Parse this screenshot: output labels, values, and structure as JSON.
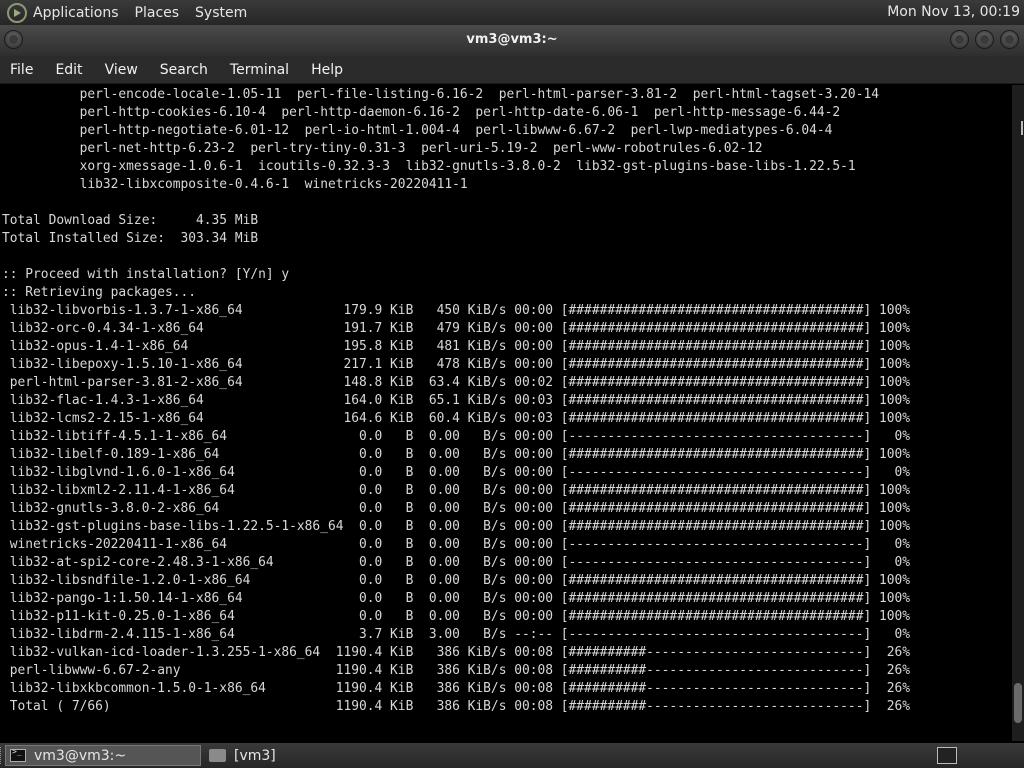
{
  "top_panel": {
    "menus": [
      "Applications",
      "Places",
      "System"
    ],
    "clock": "Mon Nov 13, 00:19"
  },
  "window": {
    "title": "vm3@vm3:~"
  },
  "menubar": [
    "File",
    "Edit",
    "View",
    "Search",
    "Terminal",
    "Help"
  ],
  "terminal": {
    "lines": [
      "          perl-encode-locale-1.05-11  perl-file-listing-6.16-2  perl-html-parser-3.81-2  perl-html-tagset-3.20-14",
      "          perl-http-cookies-6.10-4  perl-http-daemon-6.16-2  perl-http-date-6.06-1  perl-http-message-6.44-2",
      "          perl-http-negotiate-6.01-12  perl-io-html-1.004-4  perl-libwww-6.67-2  perl-lwp-mediatypes-6.04-4",
      "          perl-net-http-6.23-2  perl-try-tiny-0.31-3  perl-uri-5.19-2  perl-www-robotrules-6.02-12",
      "          xorg-xmessage-1.0.6-1  icoutils-0.32.3-3  lib32-gnutls-3.8.0-2  lib32-gst-plugins-base-libs-1.22.5-1",
      "          lib32-libxcomposite-0.4.6-1  winetricks-20220411-1",
      "",
      "Total Download Size:     4.35 MiB",
      "Total Installed Size:  303.34 MiB",
      "",
      ":: Proceed with installation? [Y/n] y",
      ":: Retrieving packages...",
      " lib32-libvorbis-1.3.7-1-x86_64             179.9 KiB   450 KiB/s 00:00 [######################################] 100%",
      " lib32-orc-0.4.34-1-x86_64                  191.7 KiB   479 KiB/s 00:00 [######################################] 100%",
      " lib32-opus-1.4-1-x86_64                    195.8 KiB   481 KiB/s 00:00 [######################################] 100%",
      " lib32-libepoxy-1.5.10-1-x86_64             217.1 KiB   478 KiB/s 00:00 [######################################] 100%",
      " perl-html-parser-3.81-2-x86_64             148.8 KiB  63.4 KiB/s 00:02 [######################################] 100%",
      " lib32-flac-1.4.3-1-x86_64                  164.0 KiB  65.1 KiB/s 00:03 [######################################] 100%",
      " lib32-lcms2-2.15-1-x86_64                  164.6 KiB  60.4 KiB/s 00:03 [######################################] 100%",
      " lib32-libtiff-4.5.1-1-x86_64                 0.0   B  0.00   B/s 00:00 [--------------------------------------]   0%",
      " lib32-libelf-0.189-1-x86_64                  0.0   B  0.00   B/s 00:00 [######################################] 100%",
      " lib32-libglvnd-1.6.0-1-x86_64                0.0   B  0.00   B/s 00:00 [--------------------------------------]   0%",
      " lib32-libxml2-2.11.4-1-x86_64                0.0   B  0.00   B/s 00:00 [######################################] 100%",
      " lib32-gnutls-3.8.0-2-x86_64                  0.0   B  0.00   B/s 00:00 [######################################] 100%",
      " lib32-gst-plugins-base-libs-1.22.5-1-x86_64  0.0   B  0.00   B/s 00:00 [######################################] 100%",
      " winetricks-20220411-1-x86_64                 0.0   B  0.00   B/s 00:00 [--------------------------------------]   0%",
      " lib32-at-spi2-core-2.48.3-1-x86_64           0.0   B  0.00   B/s 00:00 [--------------------------------------]   0%",
      " lib32-libsndfile-1.2.0-1-x86_64              0.0   B  0.00   B/s 00:00 [######################################] 100%",
      " lib32-pango-1:1.50.14-1-x86_64               0.0   B  0.00   B/s 00:00 [######################################] 100%",
      " lib32-p11-kit-0.25.0-1-x86_64                0.0   B  0.00   B/s 00:00 [######################################] 100%",
      " lib32-libdrm-2.4.115-1-x86_64                3.7 KiB  3.00   B/s --:-- [--------------------------------------]   0%",
      " lib32-vulkan-icd-loader-1.3.255-1-x86_64  1190.4 KiB   386 KiB/s 00:08 [##########----------------------------]  26%",
      " perl-libwww-6.67-2-any                    1190.4 KiB   386 KiB/s 00:08 [##########----------------------------]  26%",
      " lib32-libxkbcommon-1.5.0-1-x86_64         1190.4 KiB   386 KiB/s 00:08 [##########----------------------------]  26%",
      " Total ( 7/66)                             1190.4 KiB   386 KiB/s 00:08 [##########----------------------------]  26%"
    ]
  },
  "taskbar": {
    "tasks": [
      "vm3@vm3:~",
      "[vm3]"
    ]
  }
}
